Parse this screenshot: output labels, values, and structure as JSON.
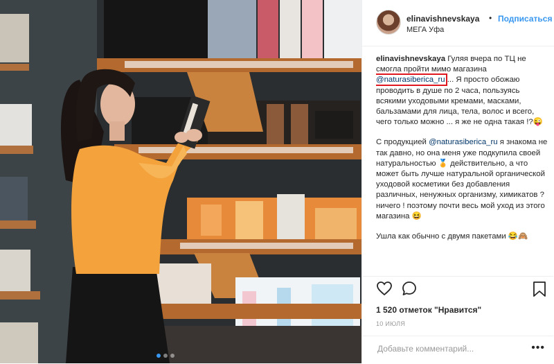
{
  "post": {
    "username": "elinavishnevskaya",
    "separator": "•",
    "follow_label": "Подписаться",
    "location": "МЕГА Уфа"
  },
  "caption": {
    "username": "elinavishnevskaya",
    "p1_before": " Гуляя вчера по ТЦ не смогла пройти мимо магазина ",
    "p1_mention": "@naturasiberica_ru",
    "p1_after": " ... Я просто обожаю проводить в душе по 2 часа, пользуясь всякими уходовыми кремами, масками, бальзамами для лица, тела, волос и всего, чего только можно ... я же не одна такая !?😜",
    "p2_before": "С продукцией ",
    "p2_mention": "@naturasiberica_ru",
    "p2_after": " я знакома не так давно, но она меня уже подкупила своей натуральностью 🏅 действительно, а что может быть лучше натуральной органической уходовой косметики без добавления различных, ненужных организму, химикатов ? ничего ! поэтому почти весь мой уход из этого магазина 😆",
    "p3": "Ушла как обычно с двумя пакетами 😂🙈"
  },
  "likes_text": "1 520 отметок \"Нравится\"",
  "date_text": "10 ИЮЛЯ",
  "comment": {
    "placeholder": "Добавьте комментарий...",
    "more": "•••"
  },
  "icons": {
    "like": "heart-icon",
    "comment": "comment-bubble-icon",
    "save": "bookmark-icon"
  },
  "colors": {
    "link": "#3897f0",
    "mention": "#003569",
    "highlight_box": "#e0171f"
  },
  "carousel": {
    "count": 3,
    "active": 1
  }
}
